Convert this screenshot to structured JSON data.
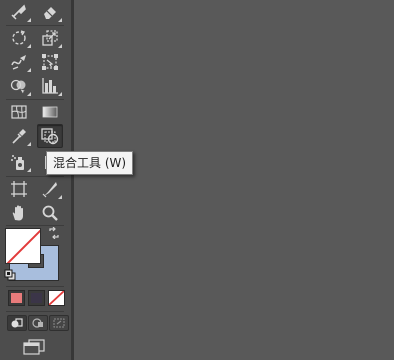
{
  "toolbar": {
    "tools": [
      {
        "name": "shaper-tool",
        "icon": "shaper-icon"
      },
      {
        "name": "eraser-tool",
        "icon": "eraser-icon"
      },
      {
        "name": "rotate-tool",
        "icon": "rotate-icon"
      },
      {
        "name": "scale-tool",
        "icon": "scale-icon"
      },
      {
        "name": "warp-tool",
        "icon": "warp-icon"
      },
      {
        "name": "free-transform-tool",
        "icon": "free-transform-icon"
      },
      {
        "name": "shape-builder-tool",
        "icon": "shape-builder-icon"
      },
      {
        "name": "graph-tool",
        "icon": "column-graph-icon"
      },
      {
        "name": "mesh-tool",
        "icon": "mesh-icon"
      },
      {
        "name": "gradient-tool",
        "icon": "gradient-icon"
      },
      {
        "name": "eyedropper-tool",
        "icon": "eyedropper-icon"
      },
      {
        "name": "blend-tool",
        "icon": "blend-icon",
        "active": true
      },
      {
        "name": "symbol-sprayer-tool",
        "icon": "symbol-sprayer-icon"
      },
      {
        "name": "artboard-tool",
        "icon": "artboard-icon"
      },
      {
        "name": "slice-tool",
        "icon": "slice-icon"
      },
      {
        "name": "hand-tool",
        "icon": "hand-icon"
      },
      {
        "name": "zoom-tool",
        "icon": "zoom-icon"
      }
    ],
    "active_tool_tooltip": "混合工具 (W)"
  },
  "colors": {
    "fill": "none",
    "stroke": "#a8bedd",
    "color_swatch": "#e87b7b",
    "gradient_swatch": "#3b3548",
    "none_swatch": "none",
    "panel_bg": "#4d4d4d",
    "canvas_bg": "#595959",
    "tooltip_bg": "#f4f4f4"
  }
}
